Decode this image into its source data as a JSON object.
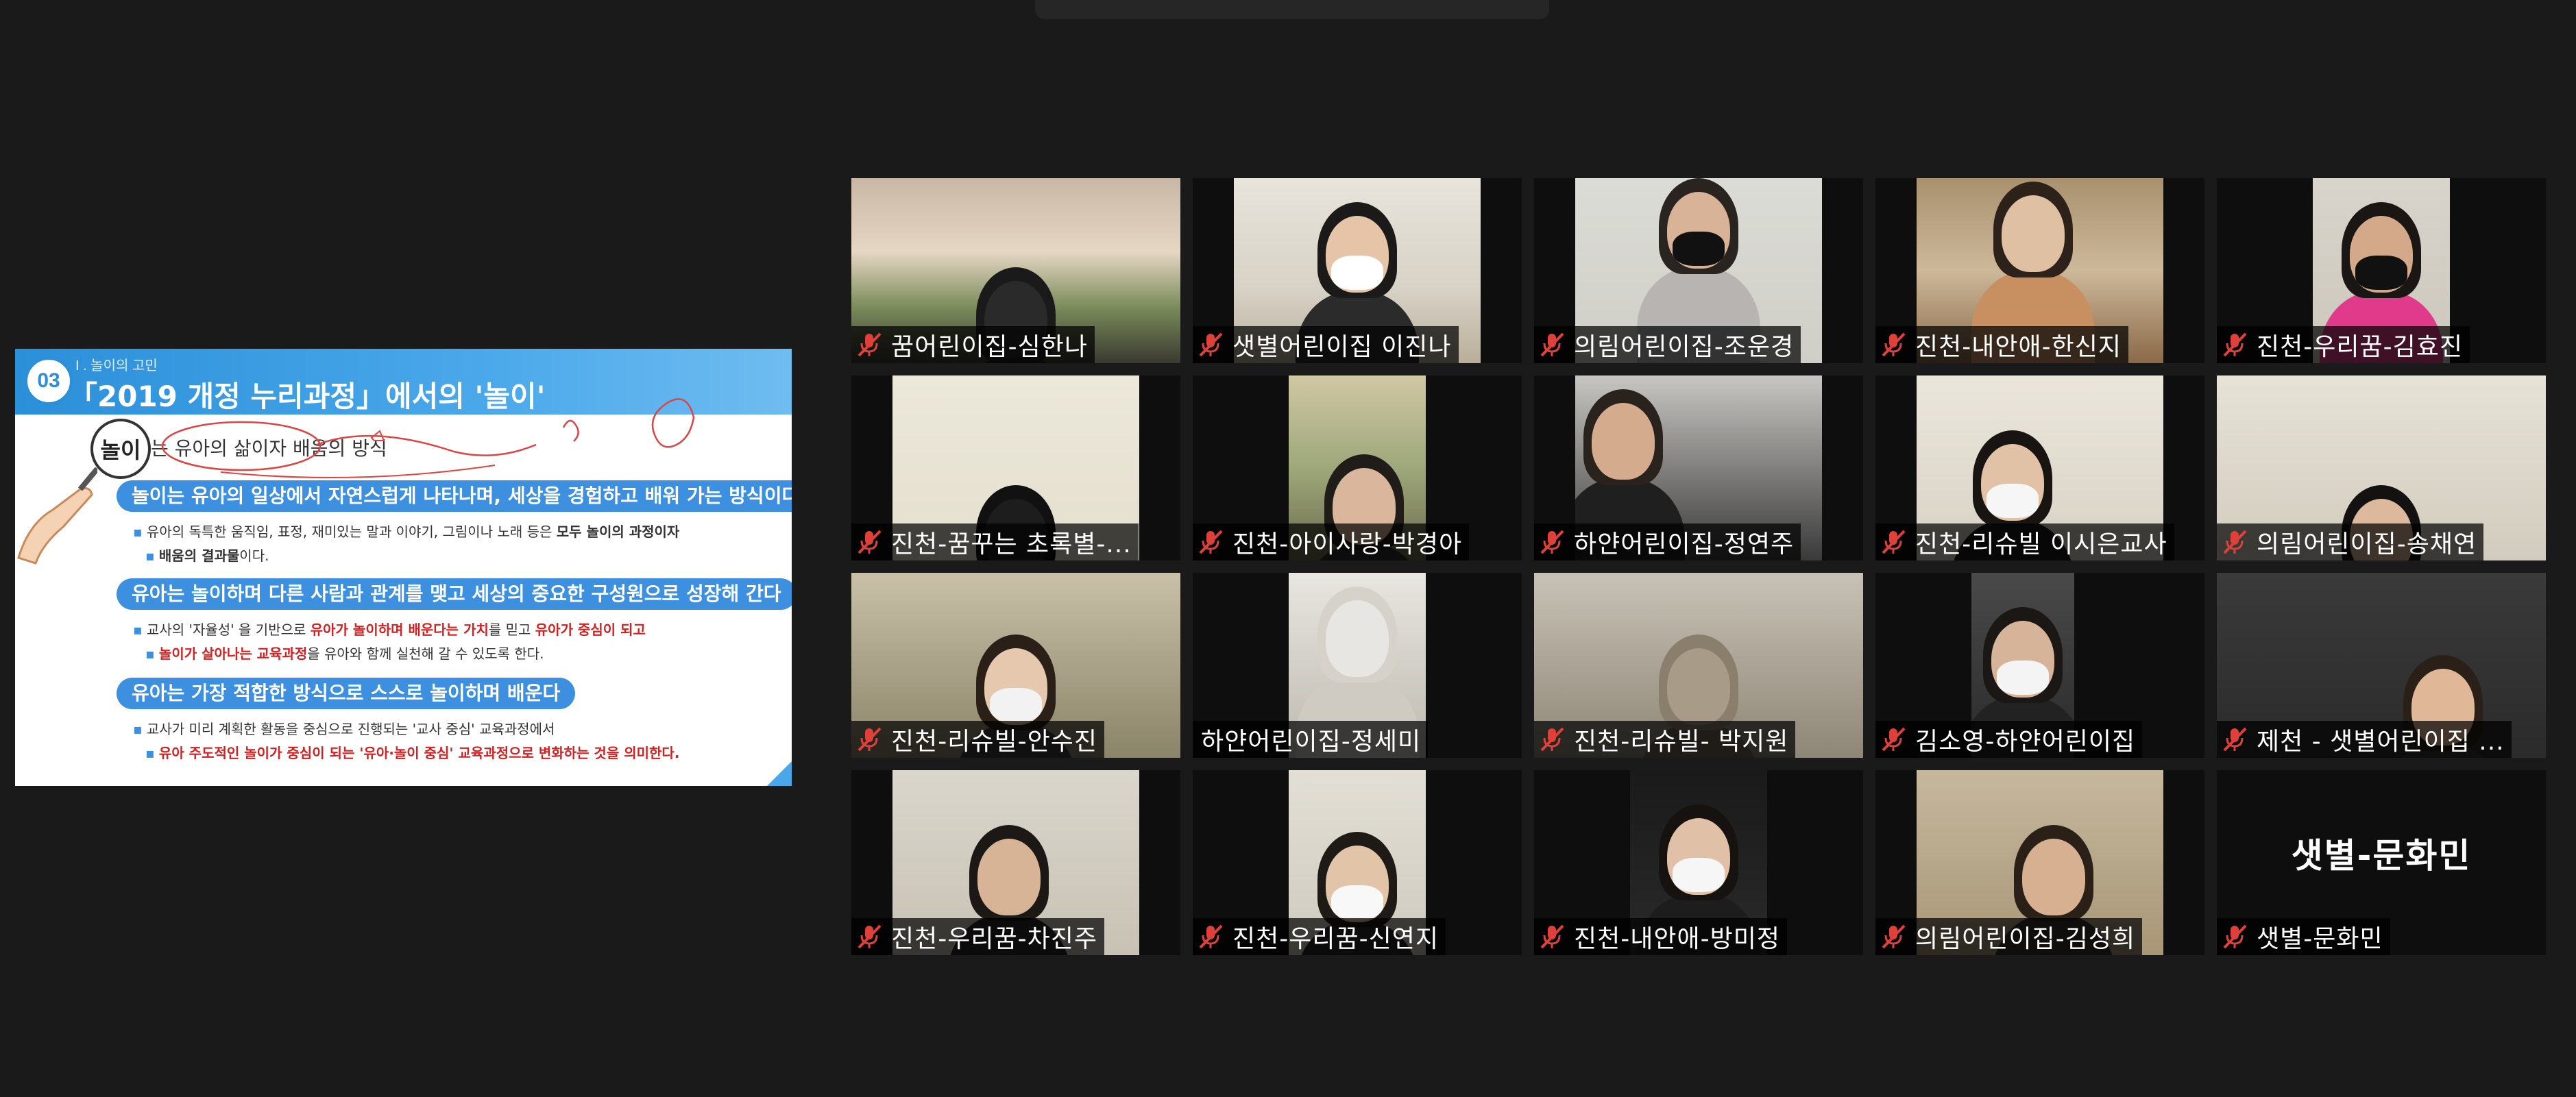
{
  "slide": {
    "section_label": "I . 놀이의 고민",
    "number": "03",
    "title": "「2019 개정 누리과정」에서의 '놀이'",
    "keyword": "놀이",
    "keyword_desc": "는 유아의 삶이자 배움의 방식",
    "points": [
      {
        "heading": "놀이는 유아의 일상에서 자연스럽게 나타나며, 세상을 경험하고 배워 가는 방식이다",
        "line1_a": "유아의 독특한 움직임, 표정, 재미있는 말과 이야기, 그림이나 노래 등은 ",
        "line1_b": "모두 놀이의 과정이자",
        "line2_a": "배움의 결과물",
        "line2_b": "이다."
      },
      {
        "heading": "유아는 놀이하며 다른 사람과 관계를 맺고 세상의 중요한 구성원으로 성장해 간다",
        "line1_a": "교사의 '자율성' 을 기반으로 ",
        "line1_b": "유아가 놀이하며 배운다는 가치",
        "line1_c": "를 믿고 ",
        "line1_d": "유아가 중심이 되고",
        "line2_a": "놀이가 살아나는 교육과정",
        "line2_b": "을 유아와 함께 실천해 갈 수 있도록 한다."
      },
      {
        "heading": "유아는 가장 적합한 방식으로 스스로 놀이하며 배운다",
        "line1_a": "교사가 미리 계획한 활동을 중심으로 진행되는 '교사 중심' 교육과정에서",
        "line2_a": "유아 주도적인 놀이가 중심이 되는 '유아·놀이 중심' 교육과정으로 변화하는 것을 의미한다."
      }
    ]
  },
  "gallery": {
    "participants": [
      {
        "name": "꿈어린이집-심한나",
        "muted": true
      },
      {
        "name": "샛별어린이집 이진나",
        "muted": true
      },
      {
        "name": "의림어린이집-조운경",
        "muted": true
      },
      {
        "name": "진천-내안애-한신지",
        "muted": true
      },
      {
        "name": "진천-우리꿈-김효진",
        "muted": true
      },
      {
        "name": "진천-꿈꾸는 초록별-...",
        "muted": true
      },
      {
        "name": "진천-아이사랑-박경아",
        "muted": true
      },
      {
        "name": "하얀어린이집-정연주",
        "muted": true
      },
      {
        "name": "진천-리슈빌 이시은교사",
        "muted": true
      },
      {
        "name": "의림어린이집-송채연",
        "muted": true
      },
      {
        "name": "진천-리슈빌-안수진",
        "muted": true
      },
      {
        "name": "하얀어린이집-정세미",
        "muted": false
      },
      {
        "name": "진천-리슈빌- 박지원",
        "muted": true
      },
      {
        "name": "김소영-하얀어린이집",
        "muted": true
      },
      {
        "name": "제천 - 샛별어린이집 ...",
        "muted": true
      },
      {
        "name": "진천-우리꿈-차진주",
        "muted": true
      },
      {
        "name": "진천-우리꿈-신연지",
        "muted": true
      },
      {
        "name": "진천-내안애-방미정",
        "muted": true
      },
      {
        "name": "의림어린이집-김성희",
        "muted": true
      },
      {
        "name": "샛별-문화민",
        "muted": true,
        "video_off": true,
        "display_name": "샛별-문화민"
      }
    ]
  },
  "colors": {
    "background": "#1a1a1a",
    "slide_accent": "#3d8fe0",
    "muted_icon": "#e0403a",
    "emphasis_red": "#d42020"
  }
}
